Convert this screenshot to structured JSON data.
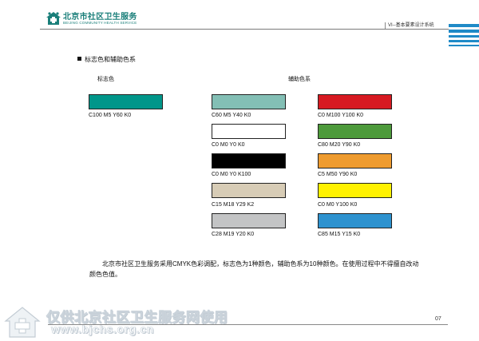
{
  "header": {
    "logo_cn": "北京市社区卫生服务",
    "logo_en": "BEIJING COMMUNITY HEALTH SERVICE",
    "title": "VI--基本要素设计系统"
  },
  "section": {
    "title": "标志色和辅助色系",
    "brand_label": "标志色",
    "aux_label": "辅助色系"
  },
  "brand_color": {
    "code": "C100 M5 Y60 K0",
    "hex": "#00968A"
  },
  "aux_left": [
    {
      "code": "C60   M5   Y40   K0",
      "hex": "#83BFB5"
    },
    {
      "code": "C0    M0    Y0    K0",
      "hex": "#FFFFFF"
    },
    {
      "code": "C0    M0    Y0    K100",
      "hex": "#000000"
    },
    {
      "code": "C15   M18   Y29   K2",
      "hex": "#D7CCB6"
    },
    {
      "code": "C28   M19   Y20   K0",
      "hex": "#C3C4C5"
    }
  ],
  "aux_right": [
    {
      "code": "C0   M100   Y100   K0",
      "hex": "#D71A21"
    },
    {
      "code": "C80   M20   Y90   K0",
      "hex": "#4D9A3B"
    },
    {
      "code": "C5   M50   Y90   K0",
      "hex": "#EE9B2F"
    },
    {
      "code": "C0   M0    Y100   K0",
      "hex": "#FFF100"
    },
    {
      "code": "C85   M15   Y15   K0",
      "hex": "#2E92CF"
    }
  ],
  "description": "北京市社区卫生服务采用CMYK色彩调配，标志色为1种颜色，辅助色系为10种颜色。在使用过程中不得擅自改动颜色色值。",
  "footer": {
    "watermark_line1": "仅供北京社区卫生服务网使用",
    "watermark_line2": "www.bjchs.org.cn",
    "page_number": "07"
  },
  "colors": {
    "accent_teal": "#1A7F7A",
    "stripe_blue": "#1F8AC7"
  }
}
